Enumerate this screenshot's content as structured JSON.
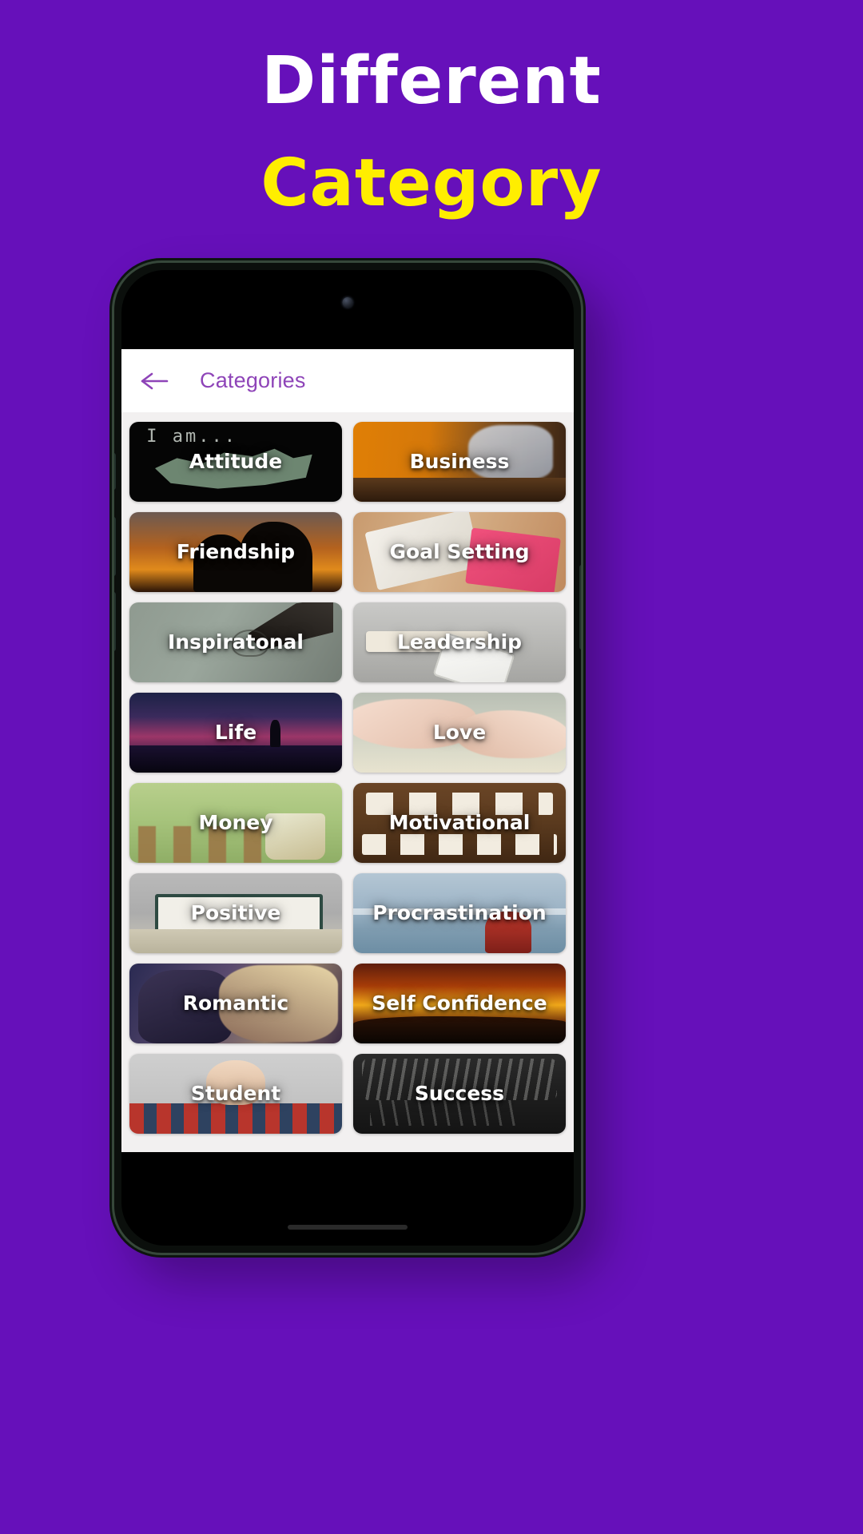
{
  "promo": {
    "line1": "Different",
    "line2": "Category",
    "line1_color": "#ffffff",
    "line2_color": "#ffee00",
    "background_color": "#6610ba"
  },
  "app": {
    "appbar": {
      "back_icon": "arrow-left-icon",
      "title": "Categories",
      "title_color": "#8e44b8",
      "background_color": "#ffffff"
    },
    "grid": {
      "columns": 2,
      "items": [
        {
          "label": "Attitude",
          "art": "art-attitude"
        },
        {
          "label": "Business",
          "art": "art-business"
        },
        {
          "label": "Friendship",
          "art": "art-friendship"
        },
        {
          "label": "Goal Setting",
          "art": "art-goal"
        },
        {
          "label": "Inspiratonal",
          "art": "art-inspiratonal"
        },
        {
          "label": "Leadership",
          "art": "art-leadership"
        },
        {
          "label": "Life",
          "art": "art-life"
        },
        {
          "label": "Love",
          "art": "art-love"
        },
        {
          "label": "Money",
          "art": "art-money"
        },
        {
          "label": "Motivational",
          "art": "art-motivational"
        },
        {
          "label": "Positive",
          "art": "art-positive"
        },
        {
          "label": "Procrastination",
          "art": "art-procrastination"
        },
        {
          "label": "Romantic",
          "art": "art-romantic"
        },
        {
          "label": "Self Confidence",
          "art": "art-selfconfidence"
        },
        {
          "label": "Student",
          "art": "art-student"
        },
        {
          "label": "Success",
          "art": "art-success"
        }
      ]
    },
    "screen_background_color": "#f2f0f0"
  }
}
